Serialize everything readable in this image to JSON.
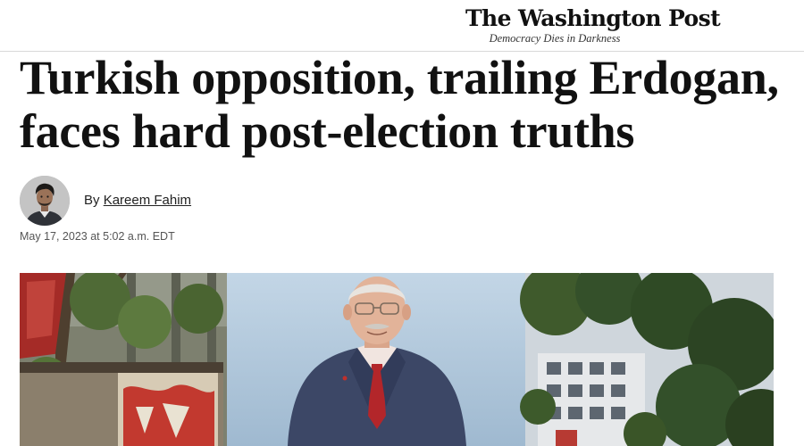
{
  "masthead": {
    "logo_name": "The Washington Post",
    "tagline": "Democracy Dies in Darkness"
  },
  "article": {
    "headline_line1": "Turkish opposition, trailing Erdogan,",
    "headline_line2": "faces hard post-election truths",
    "byline_prefix": "By",
    "author": "Kareem Fahim",
    "timestamp": "May 17, 2023 at 5:02 a.m. EDT"
  },
  "icons": {
    "avatar": "author-avatar-icon",
    "lead_photo": "lead-photo"
  }
}
